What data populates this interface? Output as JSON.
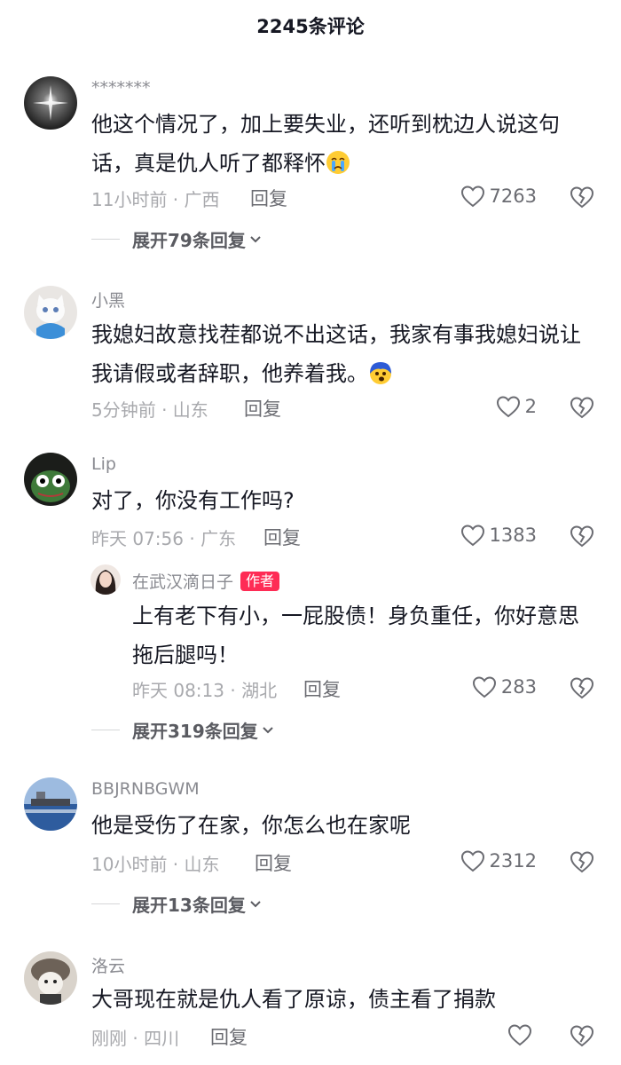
{
  "header": {
    "title": "2245条评论"
  },
  "comments": [
    {
      "username": "*******",
      "text": "他这个情况了，加上要失业，还听到枕边人说这句话，真是仇人听了都释怀",
      "emoji": "crying-face-emoji",
      "meta": "11小时前 · 广西",
      "reply_label": "回复",
      "likes": "7263",
      "expand_label": "展开79条回复"
    },
    {
      "username": "小黑",
      "text": "我媳妇故意找茬都说不出这话，我家有事我媳妇说让我请假或者辞职，他养着我。",
      "emoji": "shocked-face-emoji",
      "meta": "5分钟前 · 山东",
      "reply_label": "回复",
      "likes": "2"
    },
    {
      "username": "Lip",
      "text": "对了，你没有工作吗?",
      "meta": "昨天 07:56 · 广东",
      "reply_label": "回复",
      "likes": "1383",
      "reply": {
        "username": "在武汉滴日子",
        "badge": "作者",
        "text": "上有老下有小，一屁股债！身负重任，你好意思拖后腿吗！",
        "meta": "昨天 08:13 · 湖北",
        "reply_label": "回复",
        "likes": "283"
      },
      "expand_label": "展开319条回复"
    },
    {
      "username": "BBJRNBGWM",
      "text": "他是受伤了在家，你怎么也在家呢",
      "meta": "10小时前 · 山东",
      "reply_label": "回复",
      "likes": "2312",
      "expand_label": "展开13条回复"
    },
    {
      "username": "洛云",
      "text": "大哥现在就是仇人看了原谅，债主看了捐款",
      "meta": "刚刚 · 四川",
      "reply_label": "回复",
      "likes": ""
    }
  ],
  "colors": {
    "text": "#161823",
    "meta": "#a8a9ad",
    "accent": "#fe2c55"
  }
}
